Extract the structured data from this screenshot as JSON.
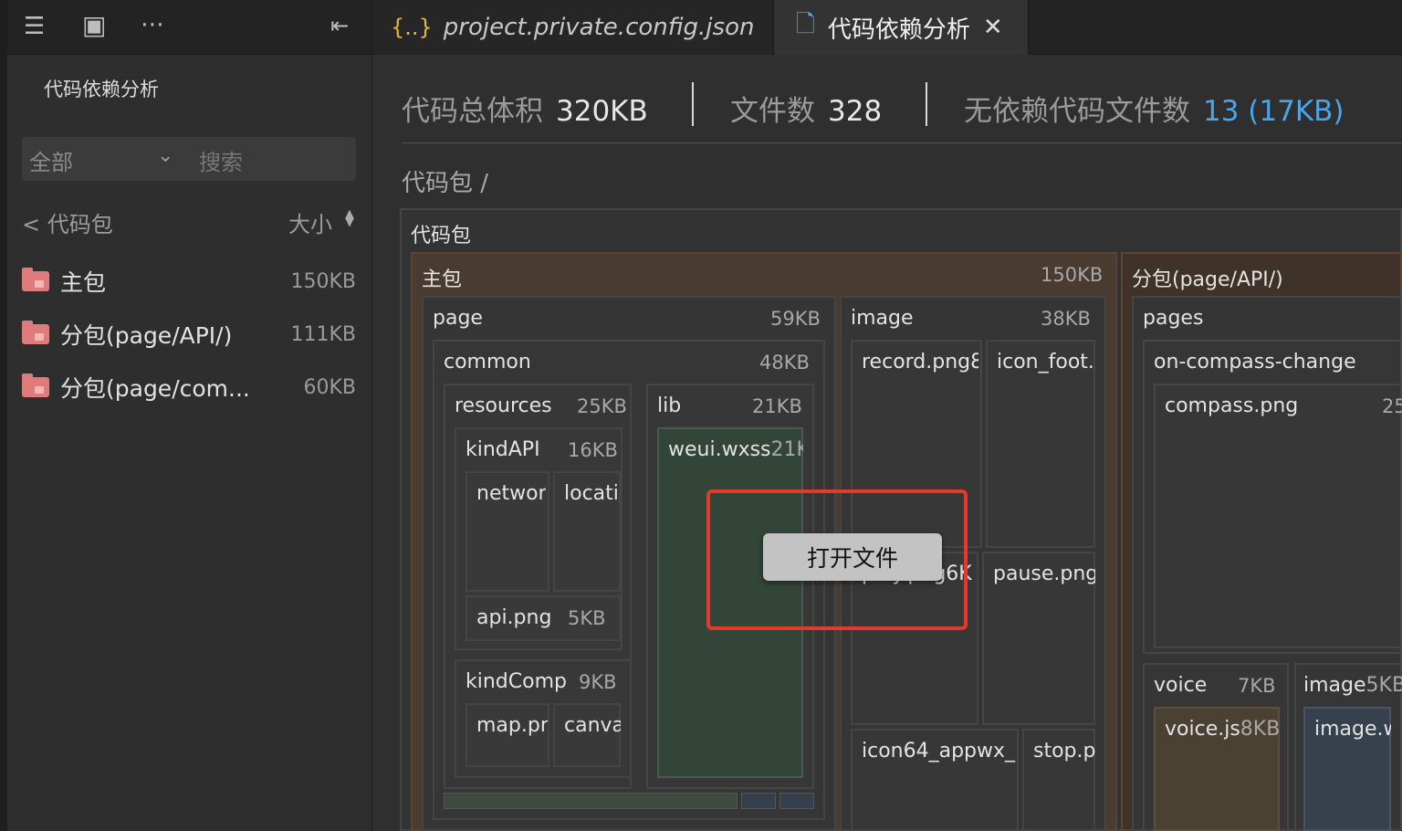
{
  "tabs": [
    {
      "label": "project.private.config.json",
      "icon": "json-brace-icon"
    },
    {
      "label": "代码依赖分析",
      "icon": "file-icon"
    }
  ],
  "sidebar": {
    "title": "代码依赖分析",
    "filter": {
      "selected": "全部",
      "search_placeholder": "搜索"
    },
    "back_label": "< 代码包",
    "sort_label": "大小",
    "items": [
      {
        "name": "主包",
        "size": "150KB"
      },
      {
        "name": "分包(page/API/)",
        "size": "111KB"
      },
      {
        "name": "分包(page/com...",
        "size": "60KB"
      }
    ]
  },
  "stats": {
    "total_label": "代码总体积",
    "total_value": "320KB",
    "files_label": "文件数",
    "files_value": "328",
    "nodep_label": "无依赖代码文件数",
    "nodep_value": "13 (17KB)"
  },
  "breadcrumb": "代码包 /",
  "treemap": {
    "root": "代码包",
    "main_pkg": {
      "name": "主包",
      "size": "150KB"
    },
    "sub_pkg": {
      "name": "分包(page/API/)"
    },
    "page": {
      "name": "page",
      "size": "59KB"
    },
    "common": {
      "name": "common",
      "size": "48KB"
    },
    "resources": {
      "name": "resources",
      "size": "25KB"
    },
    "kindapi": {
      "name": "kindAPI",
      "size": "16KB"
    },
    "networ": "networ",
    "locati": "locati",
    "apipng": {
      "name": "api.png",
      "size": "5KB"
    },
    "kindcomp": {
      "name": "kindComp",
      "size": "9KB"
    },
    "mappr": "map.pr",
    "canva": "canva",
    "lib": {
      "name": "lib",
      "size": "21KB"
    },
    "weui": {
      "name": "weui.wxss",
      "size": "21K"
    },
    "image": {
      "name": "image",
      "size": "38KB"
    },
    "record": "record.png8",
    "iconfoot": "icon_foot.",
    "play": "play.png6K",
    "pause": "pause.png",
    "icon64": "icon64_appwx_",
    "stop": "stop.p",
    "pages": "pages",
    "compass_change": "on-compass-change",
    "compass_png": {
      "name": "compass.png",
      "size": "25"
    },
    "voice": {
      "name": "voice",
      "size": "7KB"
    },
    "voicejs": {
      "name": "voice.js",
      "size": "8KB"
    },
    "image5": {
      "name": "image",
      "size": "5KB"
    },
    "imagew": "image.w"
  },
  "context_menu": {
    "open_file": "打开文件"
  },
  "colors": {
    "highlight": "#e33a2c",
    "accent_blue": "#4aa6e9",
    "folder": "#e07b7b"
  }
}
